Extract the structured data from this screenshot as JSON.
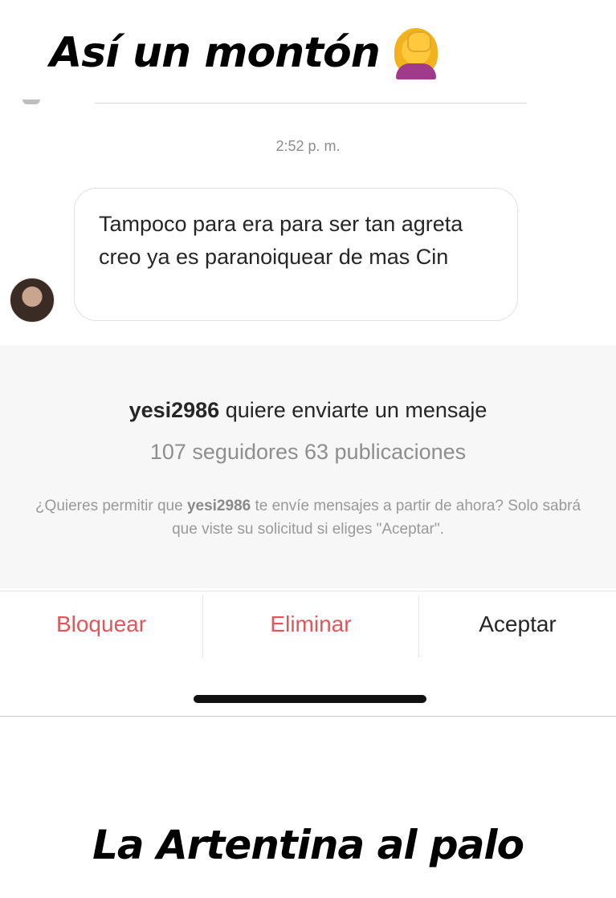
{
  "captions": {
    "top": "Así un montón",
    "bottom": "La Artentina al palo"
  },
  "icons": {
    "top_emoji": "face-palm-emoji-icon"
  },
  "chat": {
    "timestamp": "2:52 p. m.",
    "message": "Tampoco para era para ser tan agreta creo ya es paranoiquear de mas Cin"
  },
  "request": {
    "username": "yesi2986",
    "title_suffix": " quiere enviarte un mensaje",
    "stats": "107 seguidores 63 publicaciones",
    "desc_prefix": "¿Quieres permitir que ",
    "desc_user": "yesi2986",
    "desc_suffix": " te envíe mensajes a partir de ahora? Solo sabrá que viste su solicitud si eliges \"Aceptar\"."
  },
  "actions": {
    "block": "Bloquear",
    "delete": "Eliminar",
    "accept": "Aceptar"
  },
  "colors": {
    "destructive": "#e0575b",
    "text": "#262626",
    "muted": "#8e8e8e",
    "panel": "#f7f7f7"
  }
}
